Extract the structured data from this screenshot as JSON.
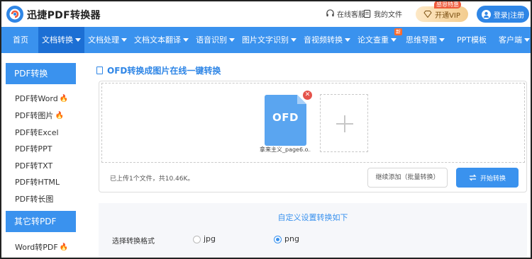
{
  "header": {
    "brand": "迅捷PDF转换器",
    "links": [
      {
        "icon": "headset-icon",
        "label": "在线客服"
      },
      {
        "icon": "document-icon",
        "label": "我的文件"
      }
    ],
    "vip": {
      "badge": "感恩特惠",
      "label": "开通VIP"
    },
    "login": {
      "label": "登录|注册"
    }
  },
  "nav": {
    "items": [
      {
        "label": "首页",
        "caret": false
      },
      {
        "label": "文档转换",
        "caret": true,
        "active": true
      },
      {
        "label": "文档处理",
        "caret": true
      },
      {
        "label": "文档文本翻译",
        "caret": true
      },
      {
        "label": "语音识别",
        "caret": true
      },
      {
        "label": "图片文字识别",
        "caret": true
      },
      {
        "label": "音视频转换",
        "caret": true
      },
      {
        "label": "论文查重",
        "caret": true,
        "badge": "新"
      },
      {
        "label": "思维导图",
        "caret": true
      },
      {
        "label": "PPT模板",
        "caret": false
      },
      {
        "label": "客户端",
        "caret": true
      }
    ]
  },
  "sidebar": {
    "group1": "PDF转换",
    "items1": [
      {
        "label": "PDF转Word",
        "hot": true
      },
      {
        "label": "PDF转图片",
        "hot": true
      },
      {
        "label": "PDF转Excel",
        "hot": false
      },
      {
        "label": "PDF转PPT",
        "hot": false
      },
      {
        "label": "PDF转TXT",
        "hot": false
      },
      {
        "label": "PDF转HTML",
        "hot": false
      },
      {
        "label": "PDF转长图",
        "hot": false
      }
    ],
    "group2": "其它转PDF",
    "items2": [
      {
        "label": "Word转PDF",
        "hot": true
      }
    ]
  },
  "main": {
    "title": "OFD转换成图片在线一键转换",
    "file": {
      "ext": "OFD",
      "name": "拿来主义_page6.o..."
    },
    "status": "已上传1个文件，共10.46K。",
    "continue_label": "继续添加（批量转换）",
    "start_label": "开始转换"
  },
  "settings": {
    "title": "自定义设置转换如下",
    "format_label": "选择转换格式",
    "options": [
      {
        "label": "jpg",
        "checked": false
      },
      {
        "label": "png",
        "checked": true
      }
    ]
  },
  "colors": {
    "primary": "#3a92ee",
    "primary_dark": "#1c6fd4",
    "hot": "#ff6a2c",
    "close": "#e5534b"
  }
}
